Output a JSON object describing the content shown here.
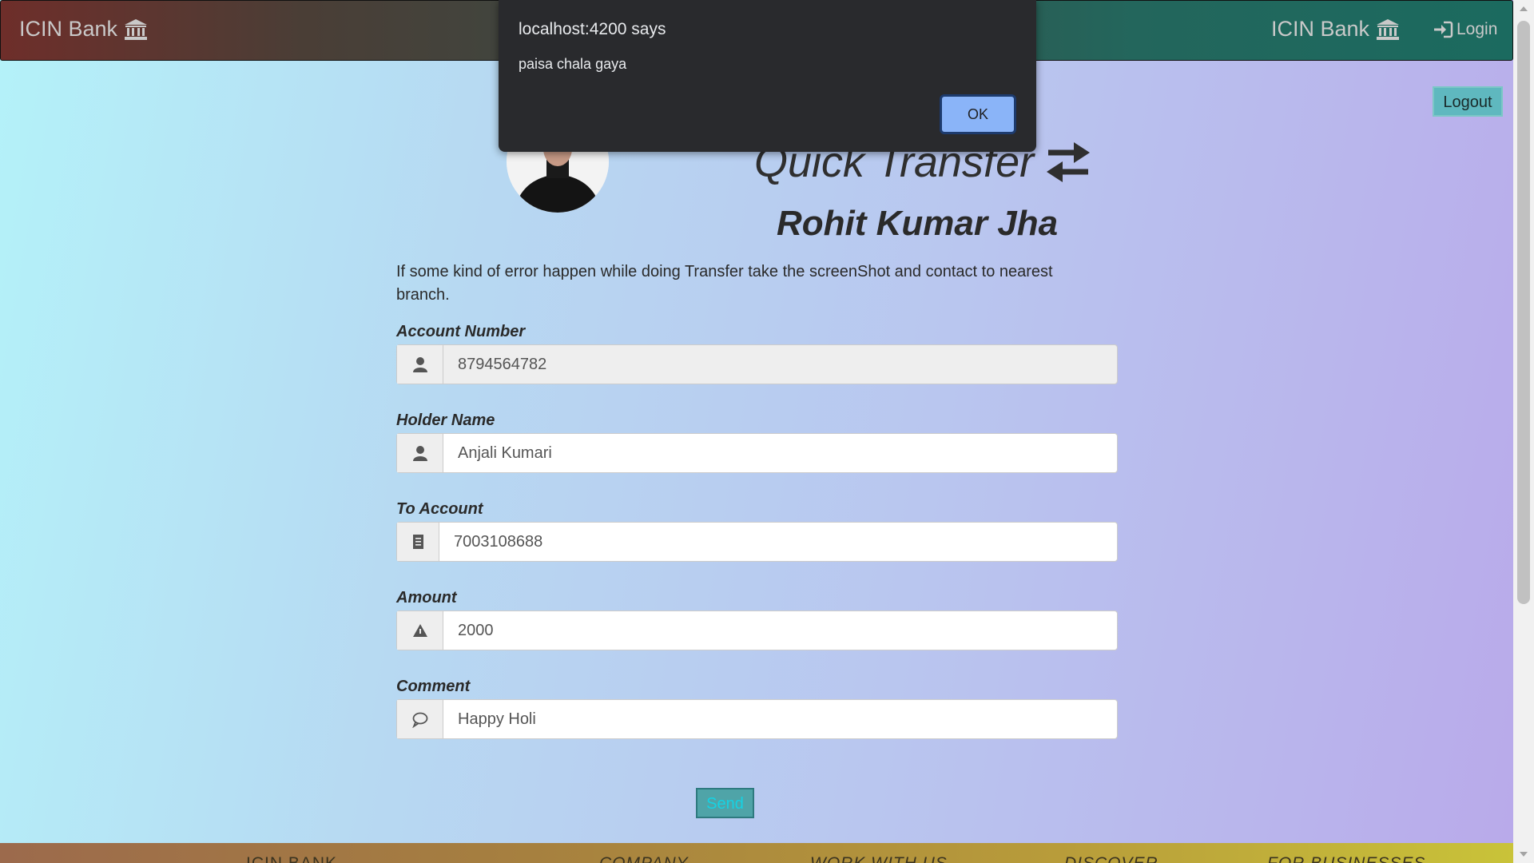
{
  "navbar": {
    "brand_left": "ICIN Bank",
    "brand_right": "ICIN Bank",
    "login_label": "Login"
  },
  "logout_label": "Logout",
  "page": {
    "title": "Quick Transfer",
    "user_name": "Rohit Kumar Jha",
    "notice": "If some kind of error happen while doing Transfer take the screenShot and contact to nearest branch."
  },
  "form": {
    "account_number": {
      "label": "Account Number",
      "value": "8794564782",
      "icon": "user-icon"
    },
    "holder_name": {
      "label": "Holder Name",
      "value": "Anjali Kumari",
      "icon": "user-icon"
    },
    "to_account": {
      "label": "To Account",
      "value": "7003108688",
      "icon": "list-alt-icon"
    },
    "amount": {
      "label": "Amount",
      "value": "2000",
      "icon": "triangle-icon"
    },
    "comment": {
      "label": "Comment",
      "value": "Happy Holi",
      "icon": "comment-icon"
    },
    "send_label": "Send"
  },
  "footer": {
    "columns": [
      "ICIN BANK",
      "COMPANY",
      "WORK WITH US",
      "DISCOVER",
      "FOR BUSINESSES"
    ]
  },
  "dialog": {
    "title": "localhost:4200 says",
    "message": "paisa chala gaya",
    "ok_label": "OK"
  },
  "colors": {
    "dialog_bg": "#292a2d",
    "dialog_button": "#8ab4f8",
    "send_button": "#4fa4a8",
    "logout_button": "#5fb8bf"
  }
}
